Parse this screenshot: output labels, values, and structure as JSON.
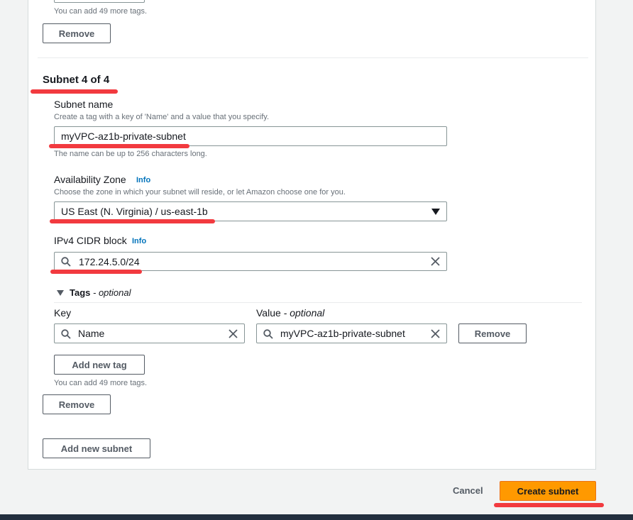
{
  "top_section": {
    "tags_hint": "You can add 49 more tags.",
    "remove_label": "Remove"
  },
  "subnet": {
    "heading": "Subnet 4 of 4",
    "name_label": "Subnet name",
    "name_desc": "Create a tag with a key of 'Name' and a value that you specify.",
    "name_value": "myVPC-az1b-private-subnet",
    "name_hint": "The name can be up to 256 characters long.",
    "az_label": "Availability Zone",
    "az_info": "Info",
    "az_desc": "Choose the zone in which your subnet will reside, or let Amazon choose one for you.",
    "az_value": "US East (N. Virginia) / us-east-1b",
    "cidr_label": "IPv4 CIDR block",
    "cidr_info": "Info",
    "cidr_value": "172.24.5.0/24",
    "tags_toggle": "Tags",
    "tags_optional": "- optional",
    "key_header": "Key",
    "value_header": "Value",
    "value_optional": "- optional",
    "tag_key": "Name",
    "tag_value": "myVPC-az1b-private-subnet",
    "tag_remove_label": "Remove",
    "add_tag_label": "Add new tag",
    "tags_hint": "You can add 49 more tags.",
    "remove_label": "Remove"
  },
  "add_subnet_label": "Add new subnet",
  "footer": {
    "cancel_label": "Cancel",
    "create_label": "Create subnet"
  },
  "colors": {
    "primary": "#ff9900",
    "annotation": "#f23a3f",
    "link": "#0073bb"
  },
  "icons": [
    "search-icon",
    "clear-icon",
    "dropdown-caret-icon",
    "expand-caret-icon"
  ]
}
